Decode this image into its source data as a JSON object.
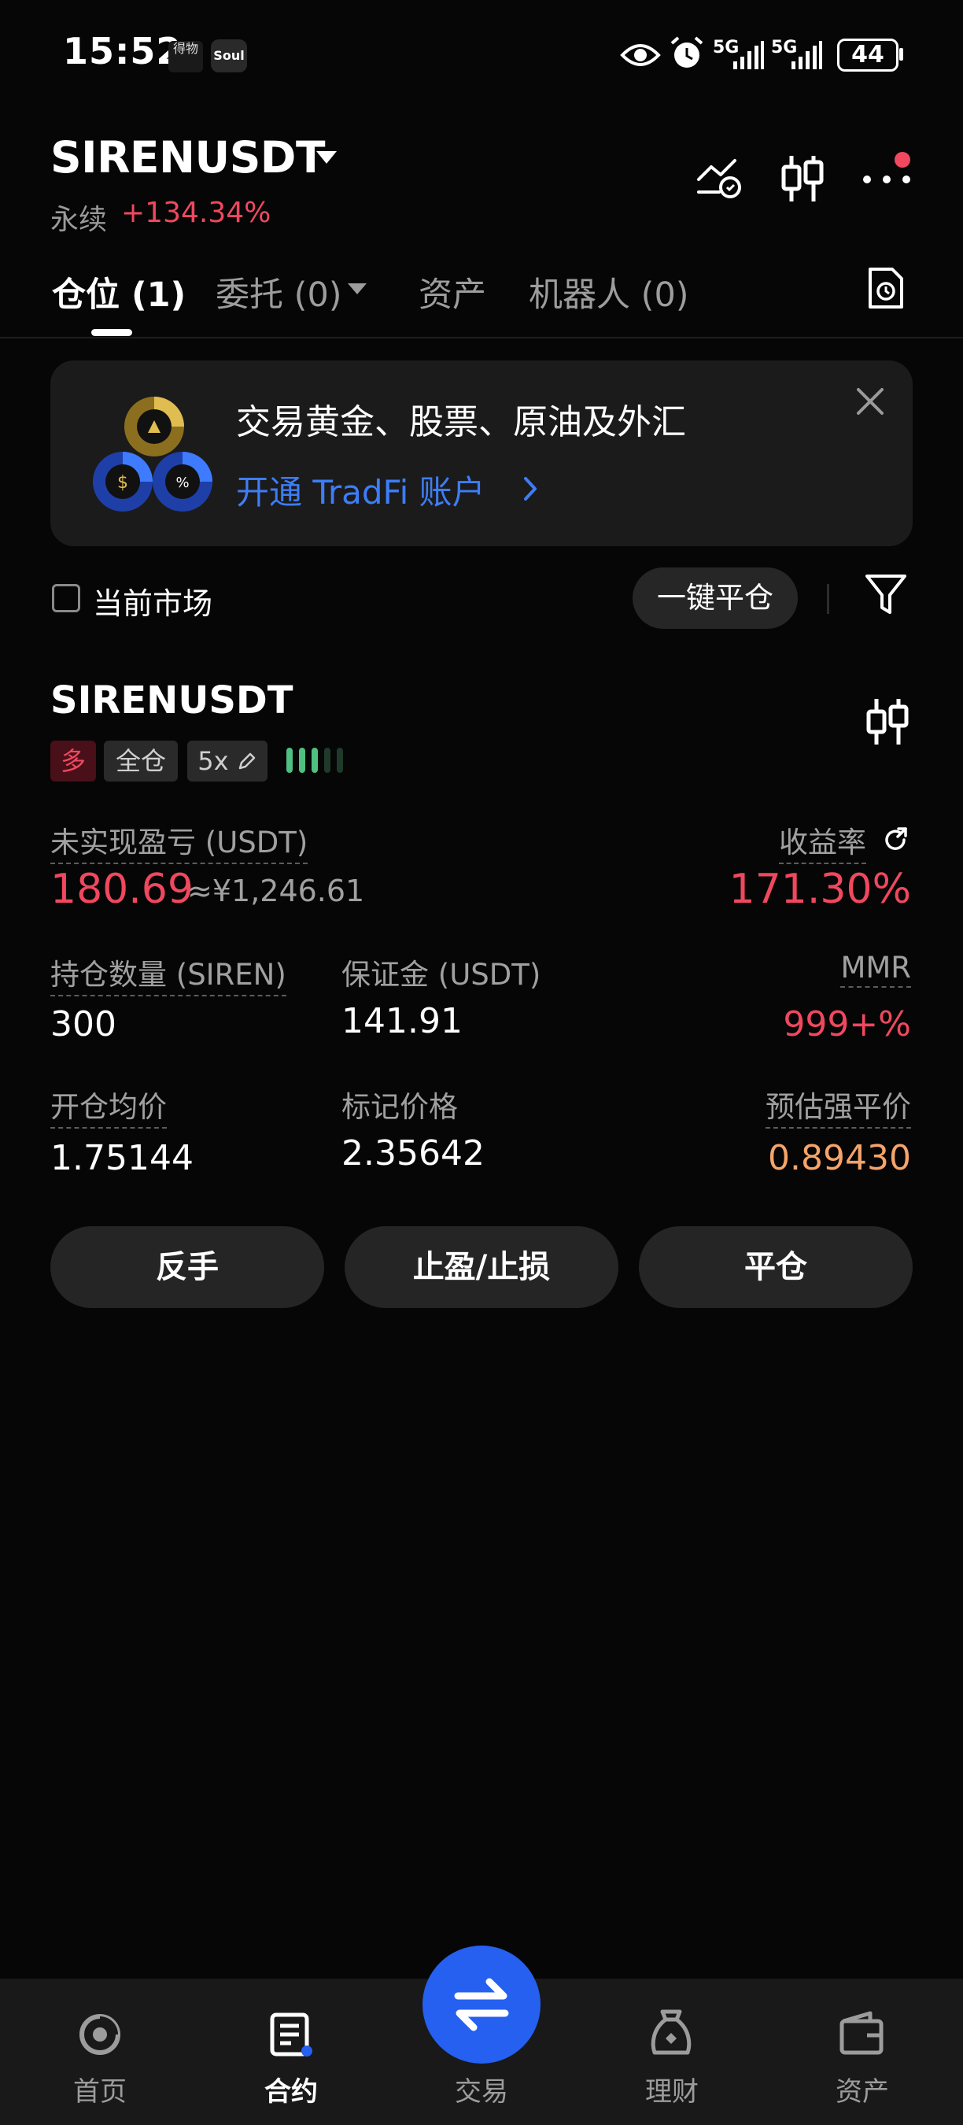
{
  "status_bar": {
    "time": "15:52",
    "app_icon_1": "得物",
    "app_icon_2": "Soul",
    "network_1": "5G",
    "network_2": "5G",
    "battery": "44"
  },
  "header": {
    "symbol": "SIRENUSDT",
    "contract_type": "永续",
    "change": "+134.34%"
  },
  "tabs": [
    {
      "label": "仓位 (1)",
      "active": true
    },
    {
      "label": "委托 (0)",
      "active": false
    },
    {
      "label": "资产",
      "active": false
    },
    {
      "label": "机器人 (0)",
      "active": false
    }
  ],
  "banner": {
    "title": "交易黄金、股票、原油及外汇",
    "link": "开通 TradFi 账户"
  },
  "filter": {
    "current_market": "当前市场",
    "close_all": "一键平仓"
  },
  "position": {
    "symbol": "SIRENUSDT",
    "side": "多",
    "margin_mode": "全仓",
    "leverage": "5x",
    "adl_level": 3,
    "adl_total": 5,
    "unrealized_pnl_label": "未实现盈亏 (USDT)",
    "unrealized_pnl": "180.69",
    "unrealized_pnl_cny": "≈¥1,246.61",
    "roe_label": "收益率",
    "roe": "171.30%",
    "size_label": "持仓数量 (SIREN)",
    "size": "300",
    "margin_label": "保证金 (USDT)",
    "margin": "141.91",
    "mmr_label": "MMR",
    "mmr": "999+%",
    "entry_price_label": "开仓均价",
    "entry_price": "1.75144",
    "mark_price_label": "标记价格",
    "mark_price": "2.35642",
    "liq_price_label": "预估强平价",
    "liq_price": "0.89430"
  },
  "actions": {
    "reverse": "反手",
    "tp_sl": "止盈/止损",
    "close": "平仓"
  },
  "nav": {
    "home": "首页",
    "futures": "合约",
    "trade": "交易",
    "earn": "理财",
    "assets": "资产"
  },
  "colors": {
    "background": "#060606",
    "up_red": "#f0485f",
    "accent_blue": "#2560f0",
    "liq_orange": "#f5a46a",
    "adl_green": "#4fbf82"
  }
}
